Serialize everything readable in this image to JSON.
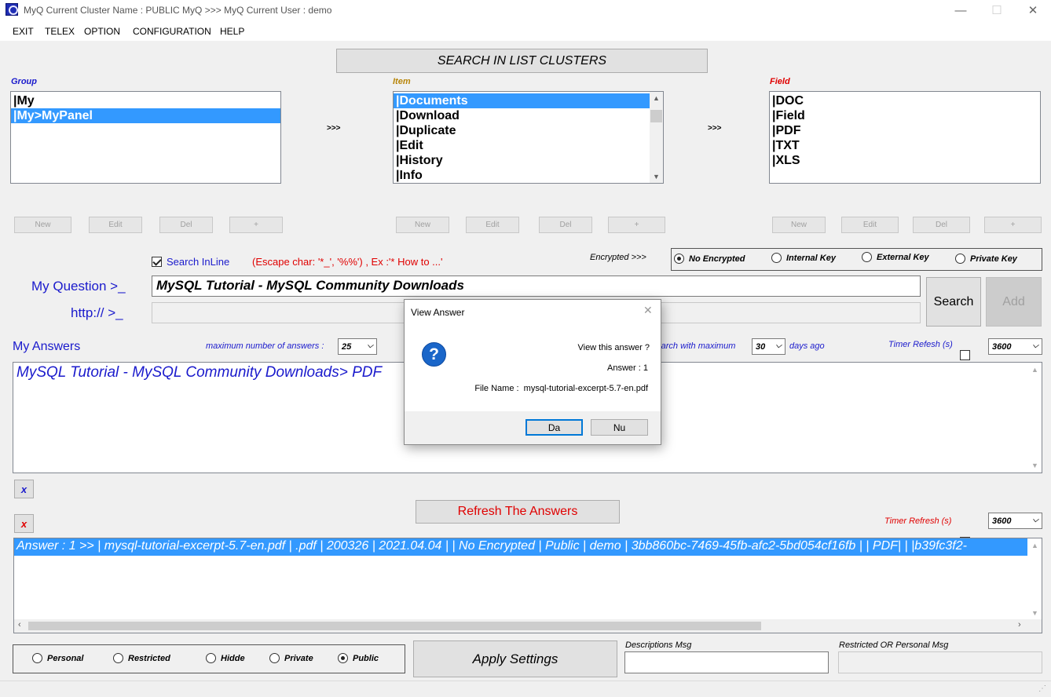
{
  "window": {
    "title": "MyQ Current Cluster Name : PUBLIC MyQ >>> MyQ Current User : demo",
    "minimize": "—",
    "maximize": "☐",
    "close": "✕"
  },
  "menu": [
    "EXIT",
    "TELEX",
    "OPTION",
    "CONFIGURATION",
    "HELP"
  ],
  "search_clusters_label": "SEARCH IN LIST CLUSTERS",
  "group": {
    "label": "Group",
    "items": [
      "|My",
      "|My>MyPanel"
    ],
    "selected": 1,
    "buttons": [
      "New",
      "Edit",
      "Del",
      "+"
    ]
  },
  "arrows": ">>>",
  "item": {
    "label": "Item",
    "items": [
      "|Documents",
      "|Download",
      "|Duplicate",
      "|Edit",
      "|History",
      "|Info"
    ],
    "selected": 0,
    "buttons": [
      "New",
      "Edit",
      "Del",
      "+"
    ]
  },
  "field": {
    "label": "Field",
    "items": [
      "|DOC",
      "|Field",
      "|PDF",
      "|TXT",
      "|XLS"
    ],
    "buttons": [
      "New",
      "Edit",
      "Del",
      "+"
    ]
  },
  "search_inline": {
    "label": "Search InLine",
    "checked": true
  },
  "escape_hint": "(Escape char: '*_', '%%') , Ex :'* How to ...'",
  "encrypted_label": "Encrypted >>>",
  "encryption": {
    "options": [
      "No Encrypted",
      "Internal Key",
      "External Key",
      "Private Key"
    ],
    "selected": 0
  },
  "question": {
    "label": "My Question >_",
    "value": "MySQL Tutorial - MySQL Community Downloads"
  },
  "http": {
    "label": "http:// >_",
    "value": ""
  },
  "search_button": "Search",
  "add_button": "Add",
  "answers": {
    "label": "My Answers",
    "max_label": "maximum number of answers :",
    "max_value": "25",
    "search_max_label": "search with maximum",
    "days_value": "30",
    "days_label": "days ago",
    "timer_label": "Timer Refesh (s)",
    "timer_value": "3600",
    "text": "MySQL Tutorial - MySQL Community Downloads> PDF"
  },
  "clear_x": "x",
  "refresh_button": "Refresh The Answers",
  "timer2": {
    "label": "Timer Refresh (s)",
    "value": "3600"
  },
  "result_row": "Answer : 1 >> | mysql-tutorial-excerpt-5.7-en.pdf | .pdf | 200326 | 2021.04.04 |  | No Encrypted | Public | demo | 3bb860bc-7469-45fb-afc2-5bd054cf16fb |  | PDF|  | |b39fc3f2-",
  "visibility": {
    "options": [
      "Personal",
      "Restricted",
      "Hidde",
      "Private",
      "Public"
    ],
    "selected": 4
  },
  "apply_button": "Apply Settings",
  "descriptions_label": "Descriptions Msg",
  "restricted_label": "Restricted OR Personal Msg",
  "dialog": {
    "title": "View Answer",
    "question": "View this answer ?",
    "answer_line": "Answer : 1",
    "file_line": "File Name :  mysql-tutorial-excerpt-5.7-en.pdf",
    "yes": "Da",
    "no": "Nu",
    "icon": "?"
  },
  "colors": {
    "blue_label": "#1a1acc",
    "item_label": "#b8860b",
    "field_label": "#e00000",
    "selection": "#3399ff",
    "red": "#e00000"
  }
}
